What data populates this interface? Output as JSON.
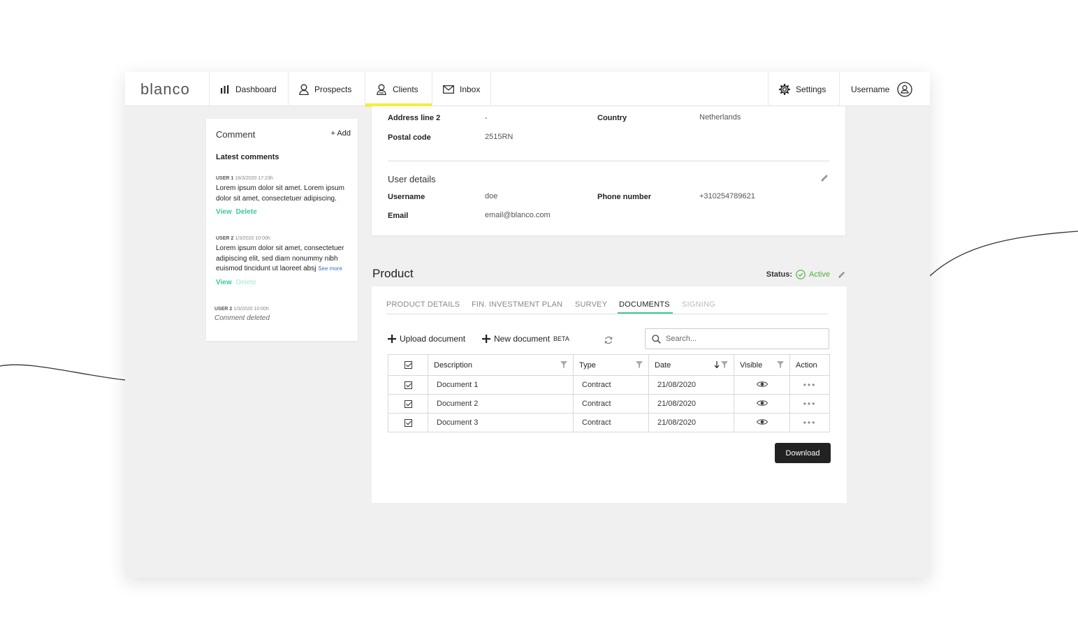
{
  "app": {
    "logo": "blanco",
    "nav": [
      {
        "label": "Dashboard"
      },
      {
        "label": "Prospects"
      },
      {
        "label": "Clients"
      },
      {
        "label": "Inbox"
      }
    ],
    "settings_label": "Settings",
    "username_label": "Username",
    "active_nav": "Clients",
    "accent_color": "#f4ef3c"
  },
  "comments": {
    "title": "Comment",
    "add_label": "+ Add",
    "latest_label": "Latest comments",
    "items": [
      {
        "user": "USER 1",
        "time": "18/3/2020 17:23h",
        "text": "Lorem ipsum dolor sit amet. Lorem ipsum dolor sit amet, consectetuer adipiscing.",
        "view": "View",
        "delete": "Delete"
      },
      {
        "user": "USER 2",
        "time": "1/3/2020 10:00h",
        "text": "Lorem ipsum dolor sit amet, consectetuer adipiscing elit, sed diam nonummy nibh euismod tincidunt ut laoreet absj",
        "see_more": "See more",
        "view": "View",
        "delete": "Delete"
      },
      {
        "user": "USER 2",
        "time": "1/3/2020 10:00h",
        "deleted_text": "Comment deleted"
      }
    ],
    "action_color": "#3fc7a0"
  },
  "details": {
    "address_line2_label": "Address line 2",
    "address_line2_value": "-",
    "country_label": "Country",
    "country_value": "Netherlands",
    "postal_code_label": "Postal code",
    "postal_code_value": "2515RN",
    "user_details_title": "User details",
    "username_label": "Username",
    "username_value": "doe",
    "phone_label": "Phone number",
    "phone_value": "+310254789621",
    "email_label": "Email",
    "email_value": "email@blanco.com"
  },
  "product": {
    "title": "Product",
    "status_label": "Status:",
    "status_value": "Active",
    "status_color": "#4caf3c",
    "tabs": [
      {
        "label": "PRODUCT DETAILS"
      },
      {
        "label": "FIN. INVESTMENT PLAN"
      },
      {
        "label": "SURVEY"
      },
      {
        "label": "DOCUMENTS"
      },
      {
        "label": "SIGNING"
      }
    ],
    "active_tab": "DOCUMENTS",
    "upload_label": "Upload document",
    "new_doc_label": "New document",
    "beta_label": "BETA",
    "search_placeholder": "Search...",
    "columns": [
      "Description",
      "Type",
      "Date",
      "Visible",
      "Action"
    ],
    "rows": [
      {
        "description": "Document 1",
        "type": "Contract",
        "date": "21/08/2020",
        "checked": true,
        "visible": true
      },
      {
        "description": "Document 2",
        "type": "Contract",
        "date": "21/08/2020",
        "checked": true,
        "visible": true
      },
      {
        "description": "Document 3",
        "type": "Contract",
        "date": "21/08/2020",
        "checked": true,
        "visible": true
      }
    ],
    "action_dots": "•••",
    "download_label": "Download"
  }
}
